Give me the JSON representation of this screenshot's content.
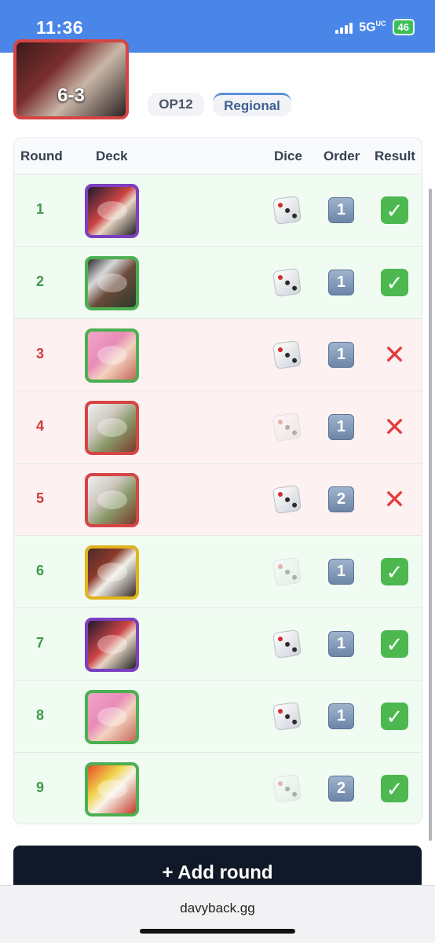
{
  "status": {
    "time": "11:36",
    "network": "5G",
    "network_sup": "UC",
    "battery": "46"
  },
  "event": {
    "score": "6-3",
    "tags": [
      "OP12",
      "Regional"
    ],
    "cover_icon": "leader-artwork"
  },
  "table": {
    "headers": {
      "round": "Round",
      "deck": "Deck",
      "dice": "Dice",
      "order": "Order",
      "result": "Result"
    },
    "rows": [
      {
        "round": "1",
        "deck_icon": "purple-leader-art",
        "deck_color": "#7b3fbf",
        "dice_won": true,
        "order": "1",
        "result": "win"
      },
      {
        "round": "2",
        "deck_icon": "green-leader-art",
        "deck_color": "#4caf50",
        "dice_won": true,
        "order": "1",
        "result": "win"
      },
      {
        "round": "3",
        "deck_icon": "pink-hair-leader-art",
        "deck_color": "#4caf50",
        "dice_won": true,
        "order": "1",
        "result": "loss"
      },
      {
        "round": "4",
        "deck_icon": "white-hair-leader-art",
        "deck_color": "#d64545",
        "dice_won": false,
        "order": "1",
        "result": "loss"
      },
      {
        "round": "5",
        "deck_icon": "white-hair-leader-art",
        "deck_color": "#d64545",
        "dice_won": true,
        "order": "2",
        "result": "loss"
      },
      {
        "round": "6",
        "deck_icon": "yellow-leader-art",
        "deck_color": "#e0b41a",
        "dice_won": false,
        "order": "1",
        "result": "win"
      },
      {
        "round": "7",
        "deck_icon": "purple-leader-art",
        "deck_color": "#7b3fbf",
        "dice_won": true,
        "order": "1",
        "result": "win"
      },
      {
        "round": "8",
        "deck_icon": "pink-hair-leader-art",
        "deck_color": "#4caf50",
        "dice_won": true,
        "order": "1",
        "result": "win"
      },
      {
        "round": "9",
        "deck_icon": "sun-god-leader-art",
        "deck_color": "#4caf50",
        "dice_won": false,
        "order": "2",
        "result": "win"
      }
    ]
  },
  "actions": {
    "add_round": "+ Add round"
  },
  "browser": {
    "url": "davyback.gg"
  }
}
